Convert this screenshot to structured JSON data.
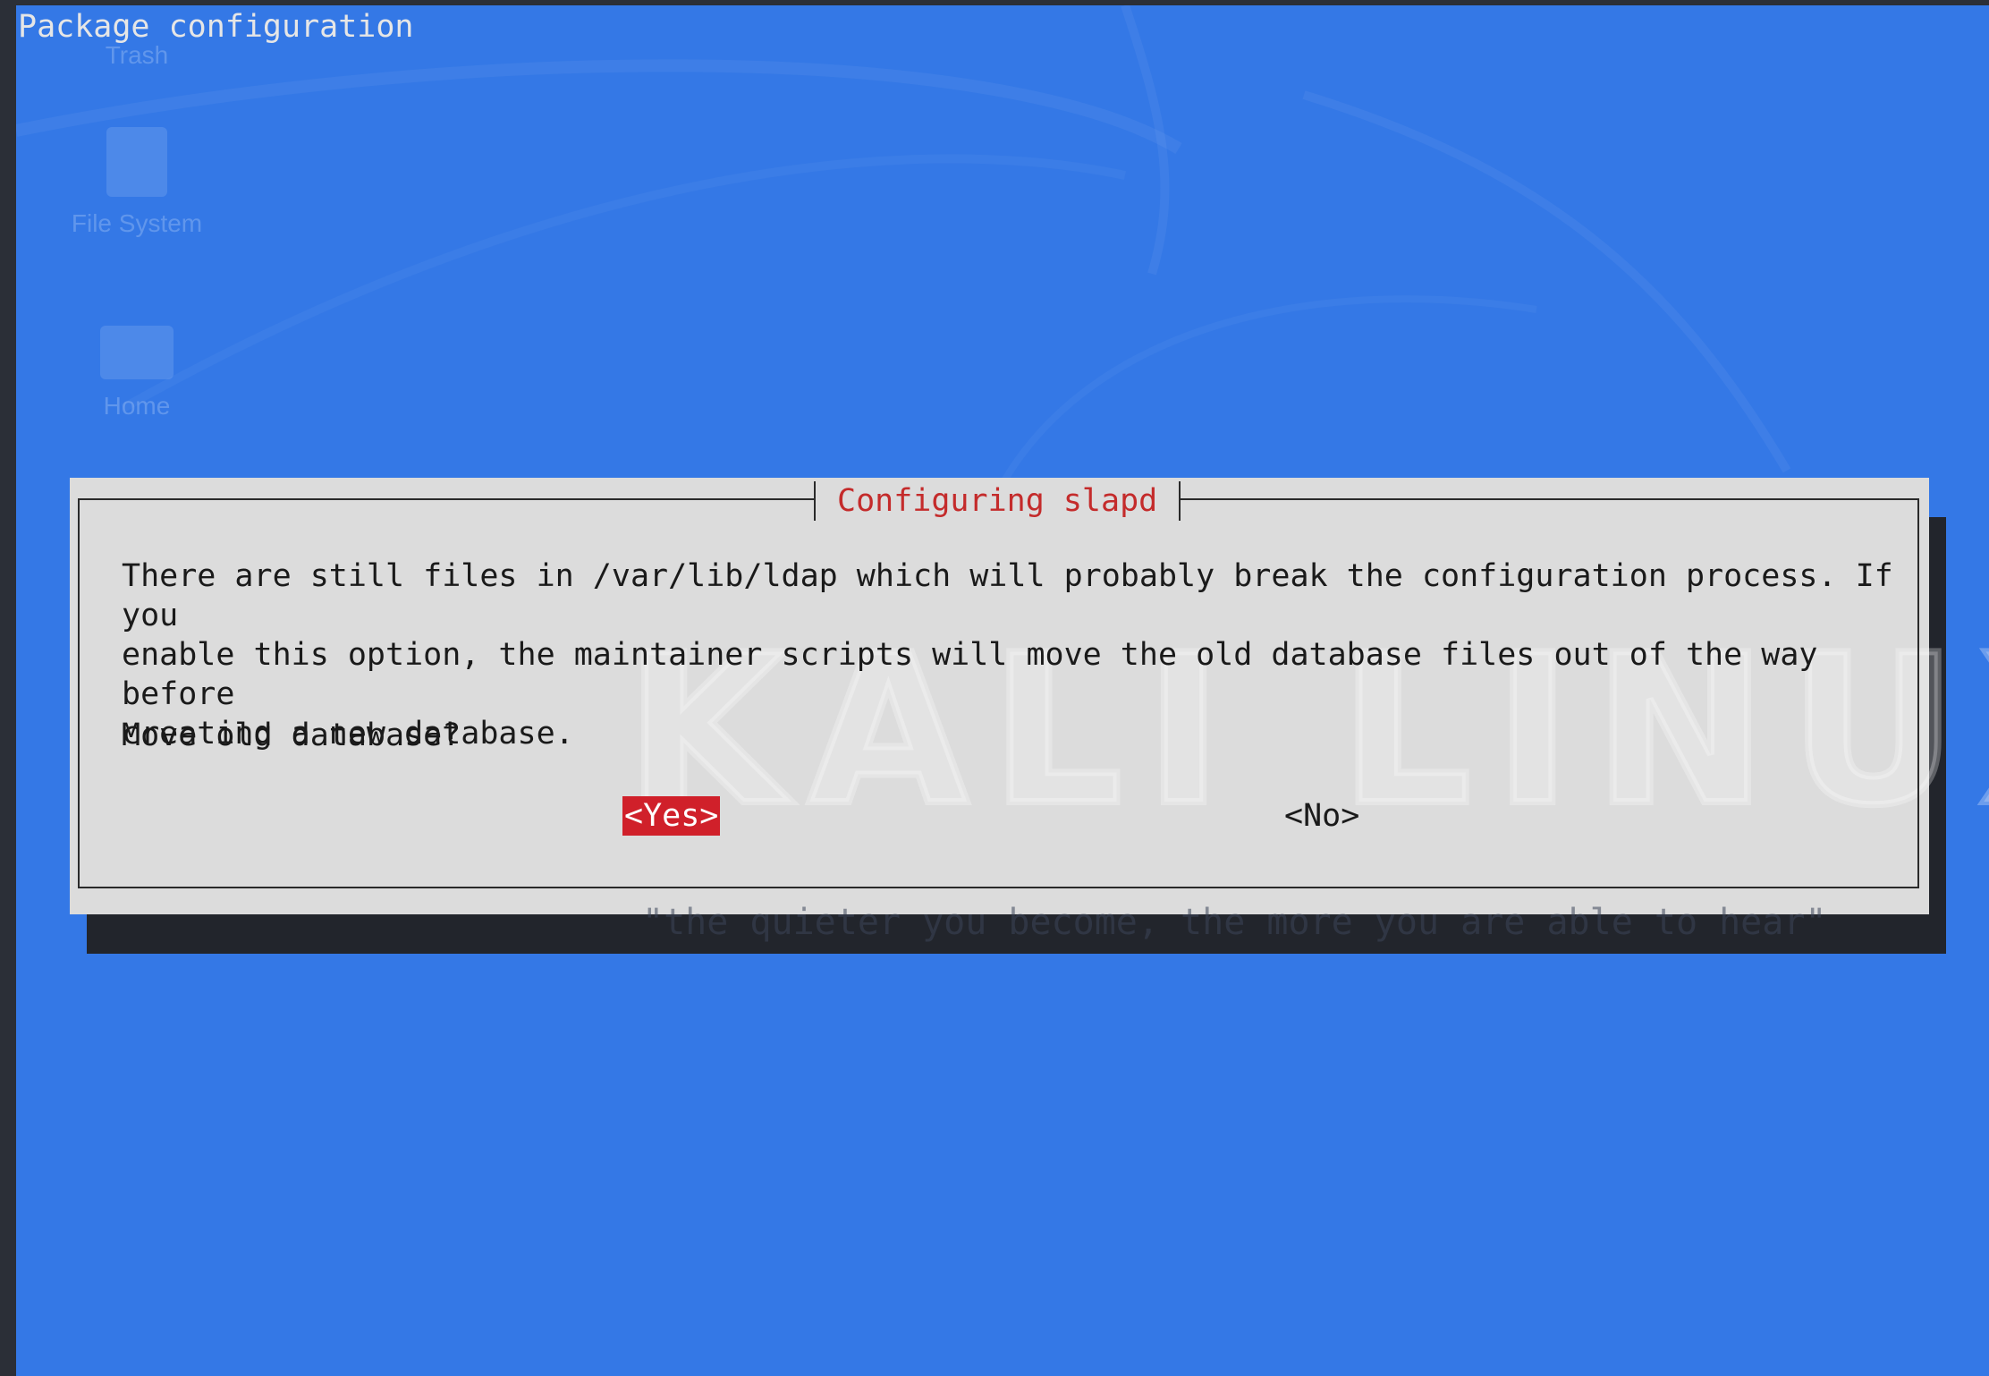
{
  "terminal": {
    "title": "Package configuration"
  },
  "desktop": {
    "icons": [
      {
        "label": "Trash",
        "icon": "trash-icon"
      },
      {
        "label": "File System",
        "icon": "drive-icon"
      },
      {
        "label": "Home",
        "icon": "home-folder-icon"
      }
    ],
    "watermark": "KALI LINUX",
    "tagline": "\"the quieter you become, the more you are able to hear\""
  },
  "dialog": {
    "title": "Configuring slapd",
    "message": "There are still files in /var/lib/ldap which will probably break the configuration process. If you\nenable this option, the maintainer scripts will move the old database files out of the way before\ncreating a new database.",
    "question": "Move old database?",
    "buttons": {
      "yes": "<Yes>",
      "no": "<No>"
    },
    "selected": "yes"
  },
  "colors": {
    "terminal_background": "#3478e6",
    "dialog_background": "#dcdcdc",
    "title_text": "#c42b2b",
    "selected_button": "#d0202a",
    "shadow": "#22252c"
  }
}
